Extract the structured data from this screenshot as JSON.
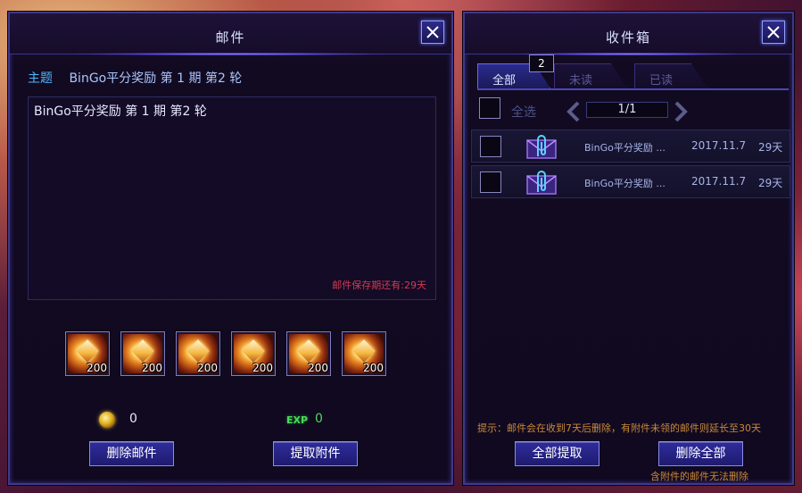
{
  "mail_panel": {
    "title": "邮件",
    "subject_label": "主题",
    "subject": "BinGo平分奖励 第 1 期 第2 轮",
    "body": "BinGo平分奖励 第 1 期 第2 轮",
    "retention_notice": "邮件保存期还有:29天",
    "attachments": [
      {
        "icon": "fire-crystal-icon",
        "quantity": "200"
      },
      {
        "icon": "fire-crystal-icon",
        "quantity": "200"
      },
      {
        "icon": "fire-crystal-icon",
        "quantity": "200"
      },
      {
        "icon": "fire-crystal-icon",
        "quantity": "200"
      },
      {
        "icon": "fire-crystal-icon",
        "quantity": "200"
      },
      {
        "icon": "fire-crystal-icon",
        "quantity": "200"
      }
    ],
    "gold": "0",
    "exp_label": "EXP",
    "exp": "0",
    "delete_button": "删除邮件",
    "claim_button": "提取附件"
  },
  "inbox_panel": {
    "title": "收件箱",
    "tabs": [
      {
        "label": "全部",
        "active": true
      },
      {
        "label": "未读",
        "active": false
      },
      {
        "label": "已读",
        "active": false
      }
    ],
    "badge_count": "2",
    "select_all": "全选",
    "page": "1/1",
    "mails": [
      {
        "subject": "BinGo平分奖励 ...",
        "date": "2017.11.7",
        "days_left": "29天",
        "icon": "envelope-attachment-icon"
      },
      {
        "subject": "BinGo平分奖励 ...",
        "date": "2017.11.7",
        "days_left": "29天",
        "icon": "envelope-attachment-icon"
      }
    ],
    "tip": "提示：邮件会在收到7天后删除，有附件未领的邮件则延长至30天",
    "claim_all_button": "全部提取",
    "delete_all_button": "删除全部",
    "delete_note": "含附件的邮件无法删除"
  },
  "colors": {
    "accent": "#4fb6ff",
    "warning": "#d33a52",
    "tip": "#c9893a",
    "exp": "#4ad85a"
  }
}
